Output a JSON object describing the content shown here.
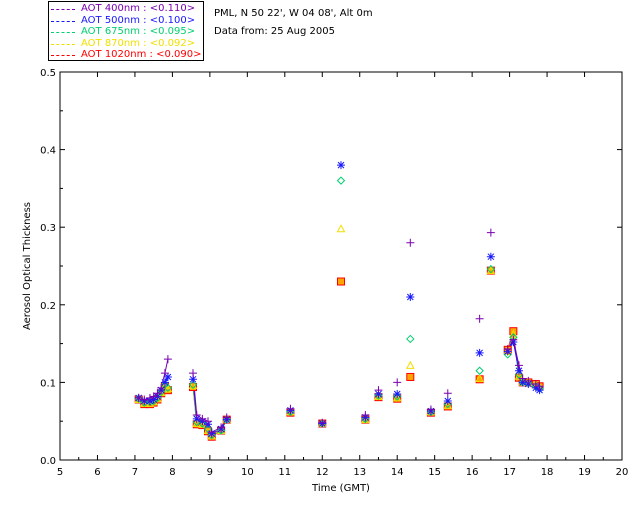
{
  "header": {
    "site_line": "PML, N 50 22', W 04 08', Alt 0m",
    "date_line": "Data from: 25 Aug 2005"
  },
  "legend": [
    {
      "label": "AOT  400nm : <0.110>",
      "color": "#7a00b0"
    },
    {
      "label": "AOT  500nm : <0.100>",
      "color": "#1818ff"
    },
    {
      "label": "AOT  675nm : <0.095>",
      "color": "#00d070"
    },
    {
      "label": "AOT  870nm : <0.092>",
      "color": "#f0e000"
    },
    {
      "label": "AOT 1020nm : <0.090>",
      "color": "#ff0000"
    }
  ],
  "chart_data": {
    "type": "scatter",
    "xlabel": "Time (GMT)",
    "ylabel": "Aerosol Optical Thickness",
    "xlim": [
      5,
      20
    ],
    "ylim": [
      0,
      0.5
    ],
    "xticks": [
      "5",
      "6",
      "7",
      "8",
      "9",
      "10",
      "11",
      "12",
      "13",
      "14",
      "15",
      "16",
      "17",
      "18",
      "19",
      "20"
    ],
    "yticks": [
      "0.0",
      "0.1",
      "0.2",
      "0.3",
      "0.4",
      "0.5"
    ],
    "series": [
      {
        "name": "AOT  400nm : <0.110>",
        "marker": "plus",
        "color": "#7a00b0",
        "x": [
          7.1,
          7.25,
          7.4,
          7.5,
          7.6,
          7.7,
          7.8,
          7.88,
          8.55,
          8.65,
          8.8,
          8.95,
          9.05,
          9.3,
          9.45,
          11.15,
          12.0,
          13.15,
          13.5,
          14.0,
          14.35,
          14.9,
          15.35,
          16.2,
          16.5,
          16.95,
          17.1,
          17.25,
          17.35,
          17.5,
          17.7,
          17.8
        ],
        "y": [
          0.08,
          0.078,
          0.08,
          0.082,
          0.086,
          0.093,
          0.112,
          0.13,
          0.112,
          0.058,
          0.053,
          0.05,
          0.036,
          0.042,
          0.055,
          0.066,
          0.048,
          0.058,
          0.09,
          0.1,
          0.28,
          0.065,
          0.086,
          0.182,
          0.293,
          0.143,
          0.155,
          0.122,
          0.105,
          0.102,
          0.098,
          0.095
        ]
      },
      {
        "name": "AOT  500nm : <0.100>",
        "marker": "asterisk",
        "color": "#1818ff",
        "x": [
          7.1,
          7.25,
          7.4,
          7.5,
          7.6,
          7.7,
          7.8,
          7.88,
          8.55,
          8.65,
          8.8,
          8.95,
          9.05,
          9.3,
          9.45,
          11.15,
          12.0,
          12.5,
          13.15,
          13.5,
          14.0,
          14.35,
          14.9,
          15.35,
          16.2,
          16.5,
          16.95,
          17.1,
          17.25,
          17.35,
          17.5,
          17.7,
          17.8
        ],
        "y": [
          0.08,
          0.076,
          0.076,
          0.078,
          0.082,
          0.09,
          0.1,
          0.107,
          0.104,
          0.053,
          0.05,
          0.046,
          0.034,
          0.04,
          0.052,
          0.064,
          0.047,
          0.38,
          0.055,
          0.085,
          0.085,
          0.21,
          0.063,
          0.076,
          0.138,
          0.262,
          0.14,
          0.152,
          0.115,
          0.1,
          0.098,
          0.093,
          0.09
        ]
      },
      {
        "name": "AOT  675nm : <0.095>",
        "marker": "diamond",
        "color": "#00d070",
        "x": [
          7.1,
          7.25,
          7.4,
          7.5,
          7.6,
          7.7,
          7.8,
          7.88,
          8.55,
          8.65,
          8.8,
          8.95,
          9.05,
          9.3,
          9.45,
          11.15,
          12.0,
          12.5,
          13.15,
          13.5,
          14.0,
          14.35,
          14.9,
          15.35,
          16.2,
          16.5,
          16.95,
          17.1,
          17.25,
          17.35,
          17.5,
          17.7,
          17.8
        ],
        "y": [
          0.079,
          0.074,
          0.075,
          0.076,
          0.08,
          0.088,
          0.097,
          0.093,
          0.097,
          0.049,
          0.047,
          0.04,
          0.032,
          0.038,
          0.052,
          0.062,
          0.047,
          0.36,
          0.053,
          0.083,
          0.082,
          0.156,
          0.062,
          0.072,
          0.115,
          0.246,
          0.136,
          0.158,
          0.11,
          0.1,
          0.099,
          0.095,
          0.092
        ]
      },
      {
        "name": "AOT  870nm : <0.092>",
        "marker": "triangle",
        "color": "#f0e000",
        "x": [
          7.1,
          7.25,
          7.4,
          7.5,
          7.6,
          7.7,
          7.8,
          7.88,
          8.55,
          8.65,
          8.8,
          8.95,
          9.05,
          9.3,
          9.45,
          11.15,
          12.0,
          12.5,
          13.15,
          13.5,
          14.0,
          14.35,
          14.9,
          15.35,
          16.2,
          16.5,
          16.95,
          17.1,
          17.25,
          17.35,
          17.5,
          17.7,
          17.8
        ],
        "y": [
          0.078,
          0.073,
          0.073,
          0.075,
          0.079,
          0.087,
          0.096,
          0.092,
          0.096,
          0.047,
          0.046,
          0.038,
          0.031,
          0.038,
          0.052,
          0.062,
          0.047,
          0.298,
          0.052,
          0.082,
          0.08,
          0.122,
          0.062,
          0.07,
          0.105,
          0.244,
          0.14,
          0.162,
          0.108,
          0.1,
          0.1,
          0.097,
          0.094
        ]
      },
      {
        "name": "AOT 1020nm : <0.090>",
        "marker": "square",
        "color": "#ff0000",
        "x": [
          7.1,
          7.25,
          7.4,
          7.5,
          7.6,
          7.7,
          7.8,
          7.88,
          8.55,
          8.65,
          8.8,
          8.95,
          9.05,
          9.3,
          9.45,
          11.15,
          12.0,
          12.5,
          13.15,
          13.5,
          14.0,
          14.35,
          14.9,
          15.35,
          16.2,
          16.5,
          16.95,
          17.1,
          17.25,
          17.35,
          17.5,
          17.7,
          17.8
        ],
        "y": [
          0.078,
          0.072,
          0.072,
          0.074,
          0.078,
          0.086,
          0.095,
          0.09,
          0.094,
          0.046,
          0.045,
          0.037,
          0.03,
          0.038,
          0.052,
          0.061,
          0.047,
          0.23,
          0.052,
          0.081,
          0.079,
          0.107,
          0.061,
          0.069,
          0.104,
          0.244,
          0.142,
          0.166,
          0.106,
          0.1,
          0.1,
          0.098,
          0.095
        ]
      }
    ],
    "connected_segments": [
      [
        7.05,
        7.95
      ],
      [
        8.5,
        9.5
      ],
      [
        16.9,
        17.85
      ]
    ]
  }
}
